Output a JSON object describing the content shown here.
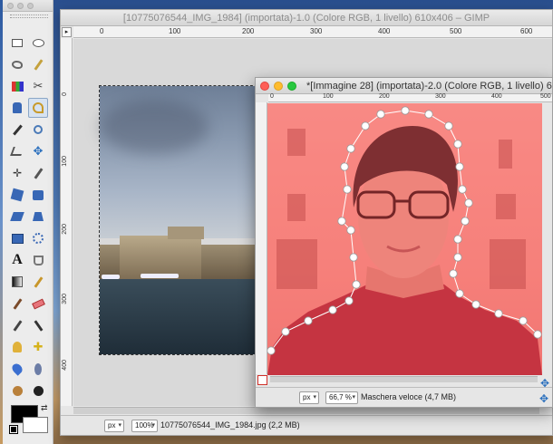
{
  "main_window": {
    "title": "[10775076544_IMG_1984] (importata)-1.0 (Colore RGB, 1 livello) 610x406 – GIMP",
    "ruler_marks": [
      "0",
      "100",
      "200",
      "300",
      "400",
      "500",
      "600"
    ],
    "status": {
      "unit": "px",
      "zoom": "100%",
      "text": "10775076544_IMG_1984.jpg (2,2 MB)"
    }
  },
  "image_window": {
    "title": "*[Immagine 28] (importata)-2.0 (Colore RGB, 1 livello) 61...",
    "ruler_marks": [
      "0",
      "100",
      "200",
      "300",
      "400",
      "500"
    ],
    "status": {
      "unit": "px",
      "zoom": "66,7 %",
      "text": "Maschera veloce (4,7 MB)"
    },
    "quick_mask_color": "#ff5a5a"
  },
  "toolbox": {
    "tools": [
      "rect-select-icon",
      "ellipse-select-icon",
      "free-select-icon",
      "fuzzy-select-icon",
      "select-by-color-icon",
      "scissors-icon",
      "foreground-select-icon",
      "paths-icon",
      "color-picker-icon",
      "zoom-icon",
      "measure-icon",
      "move-icon",
      "align-icon",
      "crop-icon",
      "rotate-icon",
      "scale-icon",
      "shear-icon",
      "perspective-icon",
      "flip-icon",
      "cage-icon",
      "text-icon",
      "bucket-fill-icon",
      "blend-icon",
      "pencil-icon",
      "paintbrush-icon",
      "eraser-icon",
      "airbrush-icon",
      "ink-icon",
      "clone-icon",
      "heal-icon",
      "smudge-icon",
      "dodge-icon",
      "desaturate-icon",
      "burn-icon"
    ],
    "foreground_color": "#000000",
    "background_color": "#ffffff"
  }
}
